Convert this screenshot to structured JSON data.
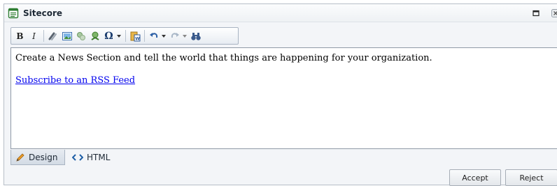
{
  "window": {
    "title": "Sitecore",
    "icons": {
      "app": "document-icon",
      "maximize": "maximize-icon",
      "close": "close-icon"
    }
  },
  "toolbar": {
    "bold_label": "B",
    "italic_label": "I",
    "special_char_label": "Ω",
    "buttons": [
      "bold",
      "italic",
      "insert-link",
      "insert-image",
      "insert-media",
      "insert-sitecore-link",
      "special-character",
      "paste-from-word",
      "undo",
      "redo",
      "find-replace"
    ]
  },
  "editor": {
    "paragraph": "Create a News Section and tell the world that things are happening for your organization.",
    "link_text": "Subscribe to an RSS Feed"
  },
  "modes": {
    "design_label": "Design",
    "html_label": "HTML",
    "active": "Design"
  },
  "footer": {
    "accept_label": "Accept",
    "reject_label": "Reject"
  },
  "colors": {
    "link": "#0000ee",
    "chrome": "#f3f5f8",
    "border": "#a9b4c2"
  }
}
